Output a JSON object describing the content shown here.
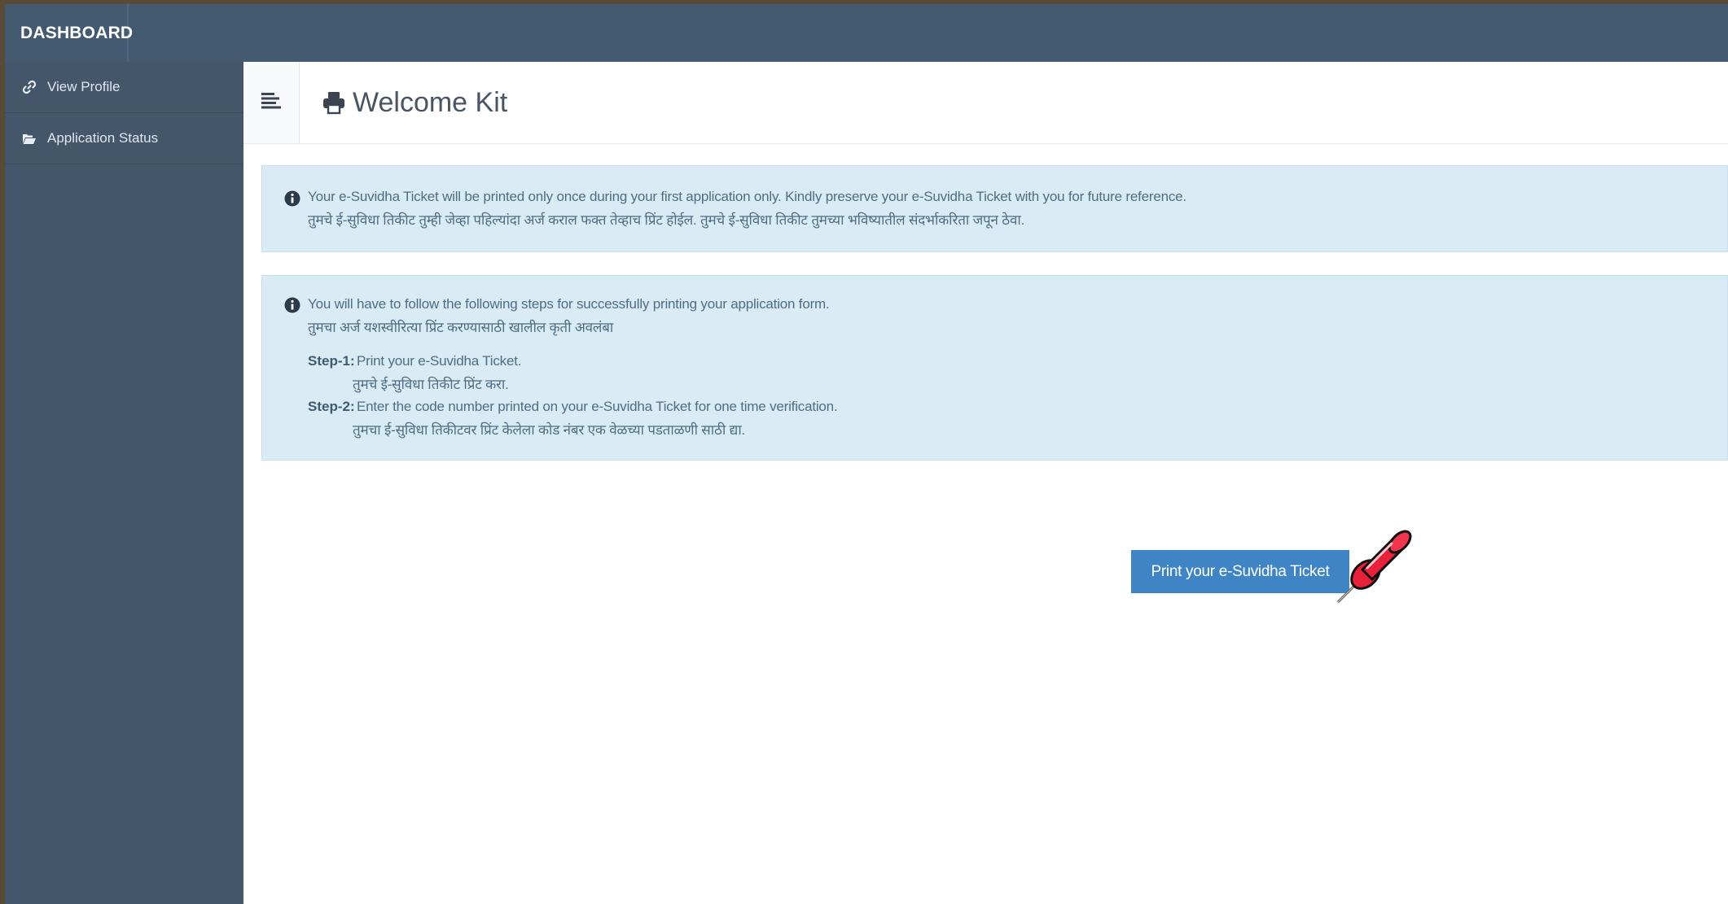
{
  "topbar": {
    "brand": "DASHBOARD"
  },
  "sidebar": {
    "items": [
      {
        "label": "View Profile",
        "icon": "link-icon"
      },
      {
        "label": "Application Status",
        "icon": "folder-open-icon"
      }
    ]
  },
  "header": {
    "title": "Welcome Kit",
    "title_icon": "printer-icon",
    "toggle_icon": "menu-toggle-icon"
  },
  "alerts": {
    "ticket_notice": {
      "line_en": "Your e-Suvidha Ticket will be printed only once during your first application only. Kindly preserve your e-Suvidha Ticket with you for future reference.",
      "line_mr": "तुमचे ई-सुविधा तिकीट तुम्ही जेव्हा पहिल्यांदा अर्ज कराल फक्त तेव्हाच प्रिंट होईल. तुमचे ई-सुविधा तिकीट तुमच्या भविष्यातील संदर्भाकरिता जपून ठेवा."
    },
    "steps_notice": {
      "line_en": "You will have to follow the following steps for successfully printing your application form.",
      "line_mr": "तुमचा अर्ज यशस्वीरित्या प्रिंट करण्यासाठी खालील कृती अवलंबा",
      "steps": [
        {
          "label": "Step-1:",
          "text_en": "Print your e-Suvidha Ticket.",
          "text_mr": "तुमचे ई-सुविधा तिकीट प्रिंट करा."
        },
        {
          "label": "Step-2:",
          "text_en": "Enter the code number printed on your e-Suvidha Ticket for one time verification.",
          "text_mr": "तुमचा ई-सुविधा तिकीटवर प्रिंट केलेला कोड नंबर एक वेळच्या पडताळणी साठी द्या."
        }
      ]
    }
  },
  "actions": {
    "print_ticket_label": "Print your e-Suvidha Ticket"
  },
  "colors": {
    "topbar": "#435a71",
    "sidebar": "#445669",
    "alert_bg": "#d9ebf4",
    "button": "#3f85c6",
    "pushpin": "#e8203a"
  }
}
